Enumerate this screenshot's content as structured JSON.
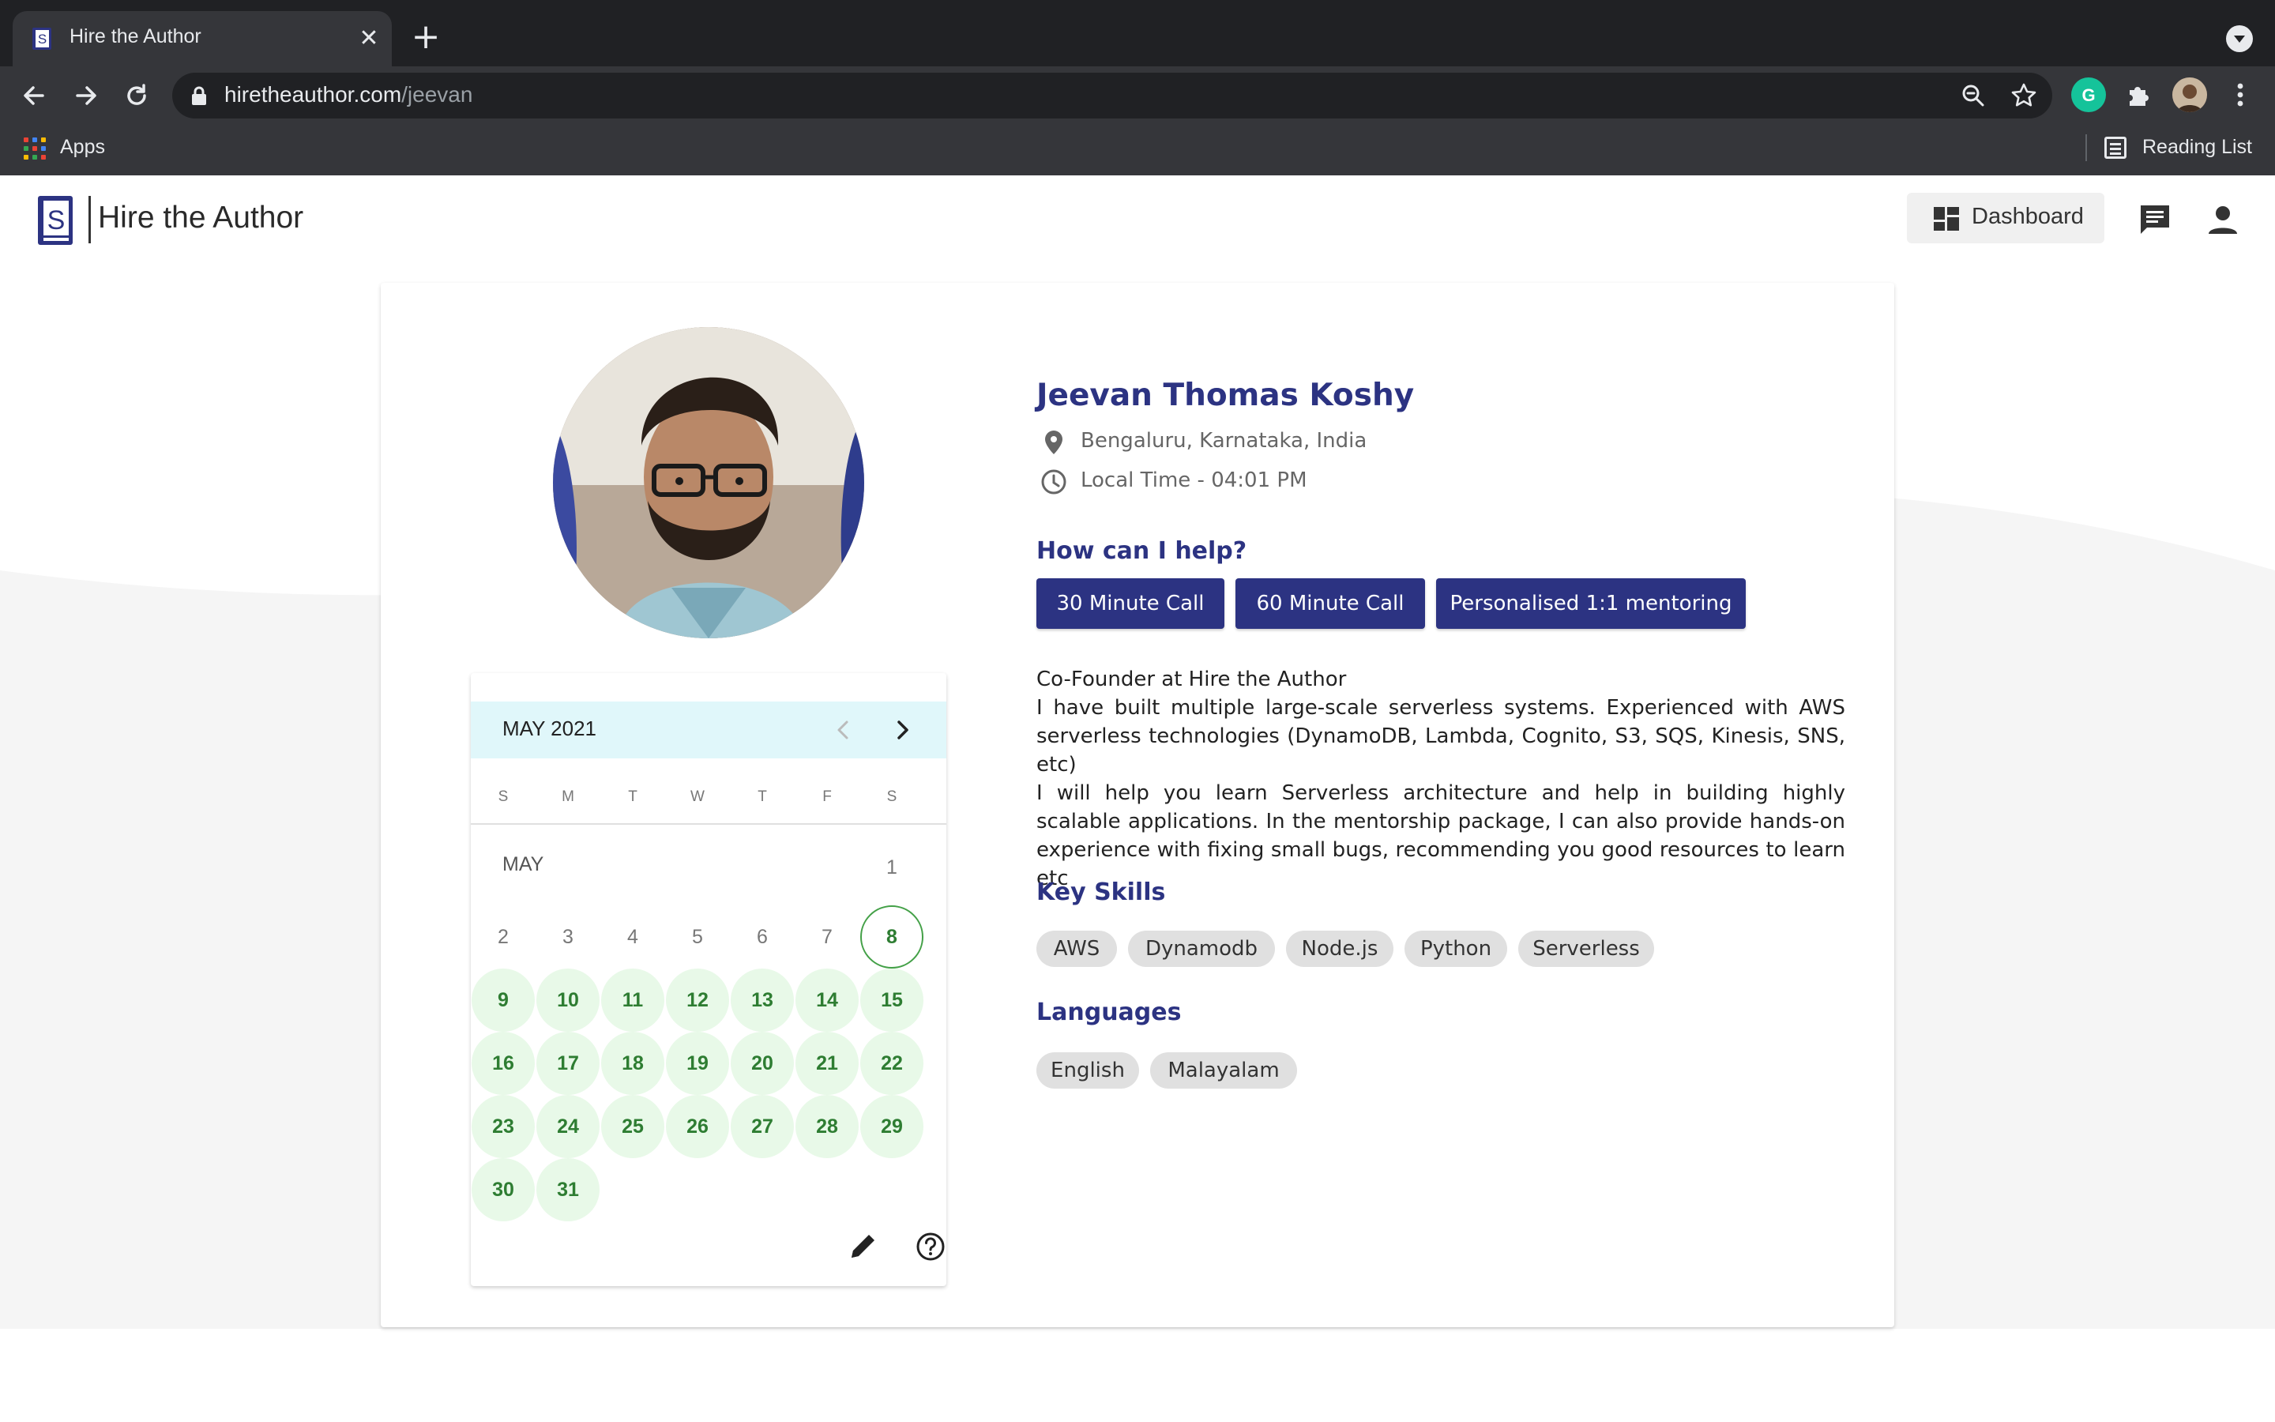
{
  "browser": {
    "tab_title": "Hire the Author",
    "url_host": "hiretheauthor.com",
    "url_path": "/jeevan",
    "bookmark_apps": "Apps",
    "reading_list": "Reading List",
    "icons": [
      "back-icon",
      "forward-icon",
      "reload-icon",
      "lock-icon",
      "zoom-icon",
      "star-icon",
      "grammarly-icon",
      "extensions-icon",
      "profile-avatar",
      "kebab-menu-icon"
    ]
  },
  "header": {
    "brand": "Hire the Author",
    "dashboard_label": "Dashboard",
    "icons": [
      "dashboard-icon",
      "chat-icon",
      "account-icon"
    ]
  },
  "profile": {
    "name": "Jeevan Thomas Koshy",
    "location": "Bengaluru, Karnataka, India",
    "local_time": "Local Time - 04:01 PM",
    "help_title": "How can I help?",
    "services": [
      "30 Minute Call",
      "60 Minute Call",
      "Personalised 1:1 mentoring"
    ],
    "bio": [
      "Co-Founder at Hire the Author",
      "I have built multiple large-scale serverless systems. Experienced with AWS serverless technologies (DynamoDB, Lambda, Cognito, S3, SQS, Kinesis, SNS, etc)",
      "I will help you learn Serverless architecture and help in building highly scalable applications. In the mentorship package, I can also provide hands-on experience with fixing small bugs, recommending you good resources to learn etc"
    ],
    "skills_title": "Key Skills",
    "skills": [
      "AWS",
      "Dynamodb",
      "Node.js",
      "Python",
      "Serverless"
    ],
    "languages_title": "Languages",
    "languages": [
      "English",
      "Malayalam"
    ]
  },
  "calendar": {
    "month_title": "MAY 2021",
    "weekdays": [
      "S",
      "M",
      "T",
      "W",
      "T",
      "F",
      "S"
    ],
    "month_label": "MAY",
    "first_weekday": 6,
    "days_in_month": 31,
    "today": 8,
    "available_from": 9,
    "colors": {
      "header_bg": "#e0f7fa",
      "available_bg": "#e8f9e8",
      "available_text": "#2e7d32",
      "today_border": "#43a047"
    }
  },
  "colors": {
    "brand_navy": "#2c3382",
    "chip_bg": "#e0e0e0"
  }
}
